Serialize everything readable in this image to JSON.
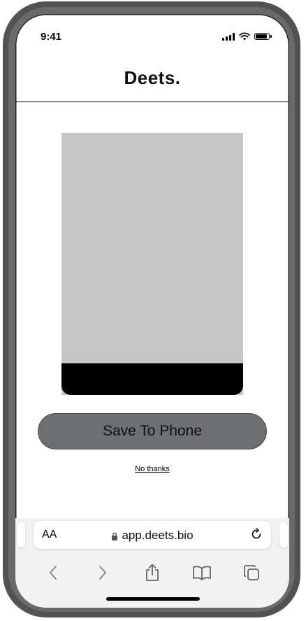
{
  "status_bar": {
    "time": "9:41"
  },
  "header": {
    "logo": "Deets."
  },
  "main": {
    "save_button_label": "Save To Phone",
    "no_thanks_label": "No thanks"
  },
  "browser": {
    "text_size_label": "AA",
    "address": "app.deets.bio"
  },
  "icons": {
    "signal": "signal-icon",
    "wifi": "wifi-icon",
    "battery": "battery-icon",
    "lock": "lock-icon",
    "reload": "reload-icon",
    "back": "back-icon",
    "forward": "forward-icon",
    "share": "share-icon",
    "bookmarks": "bookmarks-icon",
    "tabs": "tabs-icon"
  },
  "colors": {
    "button": "#6d6f71",
    "card": "#c6c6c6",
    "card_footer": "#000000",
    "browser_bar": "#f2f2f2"
  }
}
